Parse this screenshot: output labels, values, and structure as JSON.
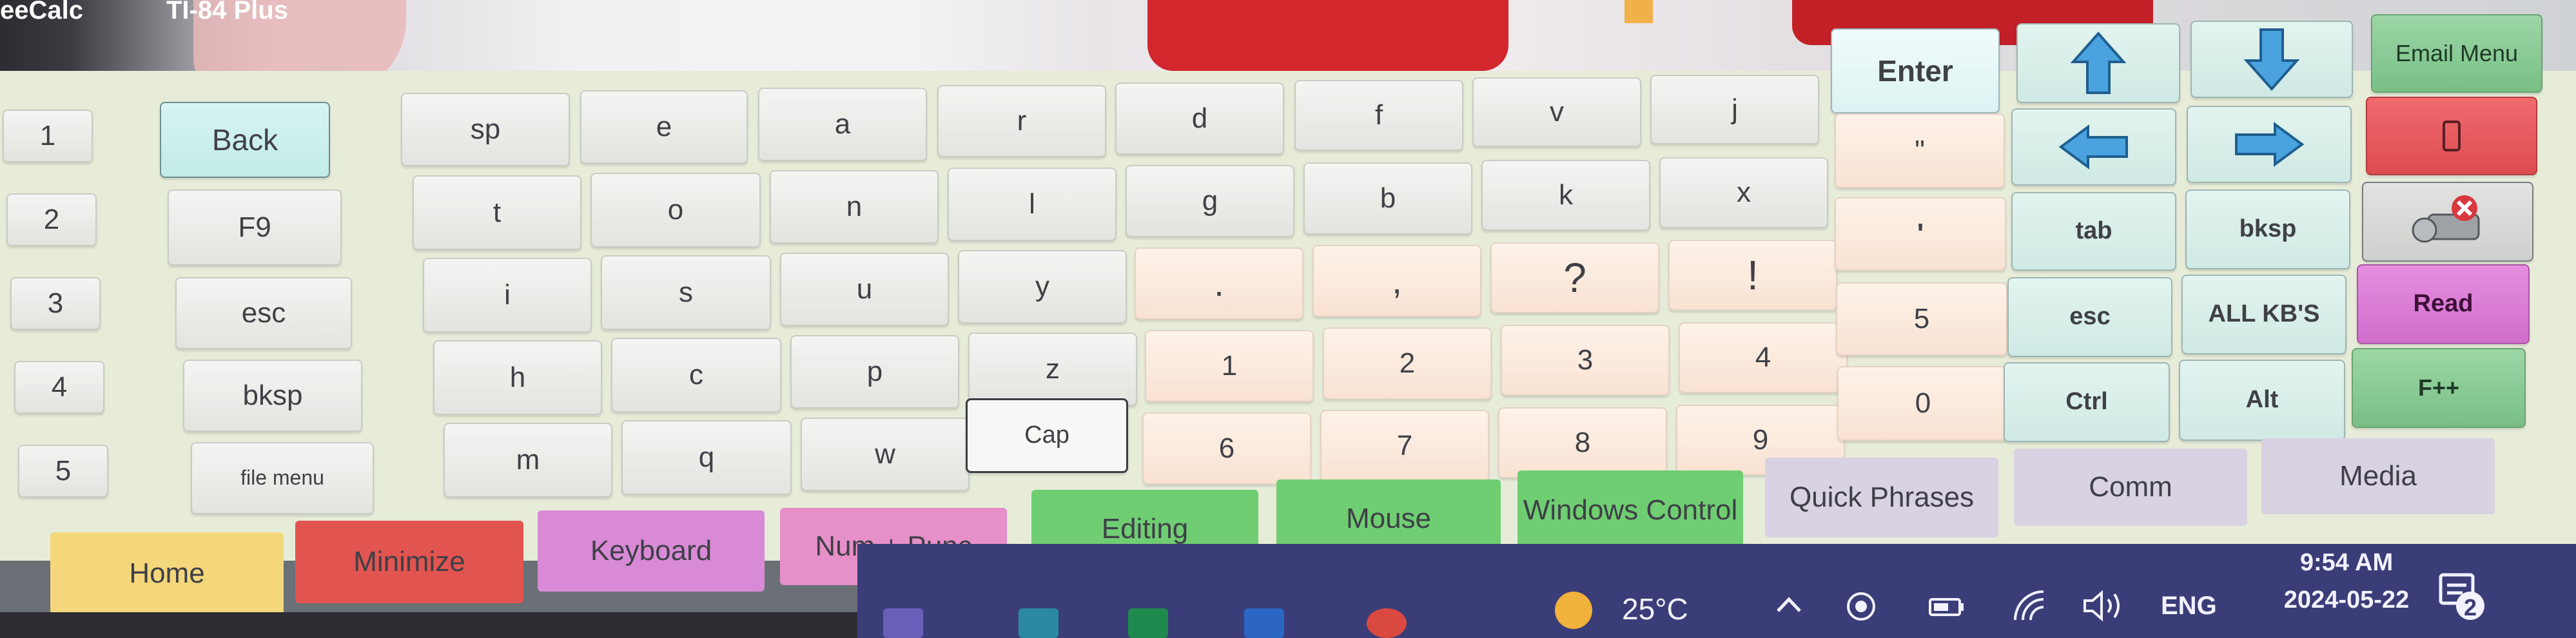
{
  "window_titles": [
    "eeCalc",
    "TI-84 Plus"
  ],
  "number_column": [
    "1",
    "2",
    "3",
    "4",
    "5"
  ],
  "function_column": [
    "Back",
    "F9",
    "esc",
    "bksp",
    "file menu"
  ],
  "letter_rows": [
    [
      "sp",
      "e",
      "a",
      "r",
      "d",
      "f",
      "v",
      "j"
    ],
    [
      "t",
      "o",
      "n",
      "l",
      "g",
      "b",
      "k",
      "x"
    ],
    [
      "i",
      "s",
      "u",
      "y",
      ".",
      ",",
      "?",
      "!"
    ],
    [
      "h",
      "c",
      "p",
      "z",
      "1",
      "2",
      "3",
      "4"
    ],
    [
      "m",
      "q",
      "w",
      "Cap",
      "6",
      "7",
      "8",
      "9"
    ]
  ],
  "punct_column": [
    "Enter",
    "\"",
    "'",
    "5",
    "0"
  ],
  "nav_keys": {
    "tab": "tab",
    "bksp": "bksp",
    "esc": "esc",
    "all_kbs": "ALL KB'S",
    "ctrl": "Ctrl",
    "alt": "Alt"
  },
  "right_column": {
    "email_menu": "Email Menu",
    "read": "Read",
    "fpp": "F++"
  },
  "categories": [
    {
      "label": "Home",
      "color": "#f4d77a"
    },
    {
      "label": "Minimize",
      "color": "#e2544f"
    },
    {
      "label": "Keyboard",
      "color": "#d98ad6"
    },
    {
      "label": "Num + Punc",
      "color": "#e68fc9"
    },
    {
      "label": "Editing",
      "color": "#6fcd72"
    },
    {
      "label": "Mouse",
      "color": "#6fcd72"
    },
    {
      "label": "Windows Control",
      "color": "#6fcd72"
    },
    {
      "label": "Quick Phrases",
      "color": "#d9d2e3"
    },
    {
      "label": "Comm",
      "color": "#d9d2e3"
    },
    {
      "label": "Media",
      "color": "#d9d2e3"
    }
  ],
  "taskbar": {
    "temperature": "25°C",
    "language": "ENG",
    "time": "9:54 AM",
    "date": "2024-05-22",
    "notification_count": "2",
    "icons": [
      "weather-sun-icon",
      "chevron-up-icon",
      "record-icon",
      "battery-icon",
      "wifi-icon",
      "speaker-icon",
      "notification-icon"
    ]
  },
  "colors": {
    "panel": "#e7ecd9",
    "arrow_blue": "#4aa3df",
    "taskbar": "#3b3d78"
  }
}
